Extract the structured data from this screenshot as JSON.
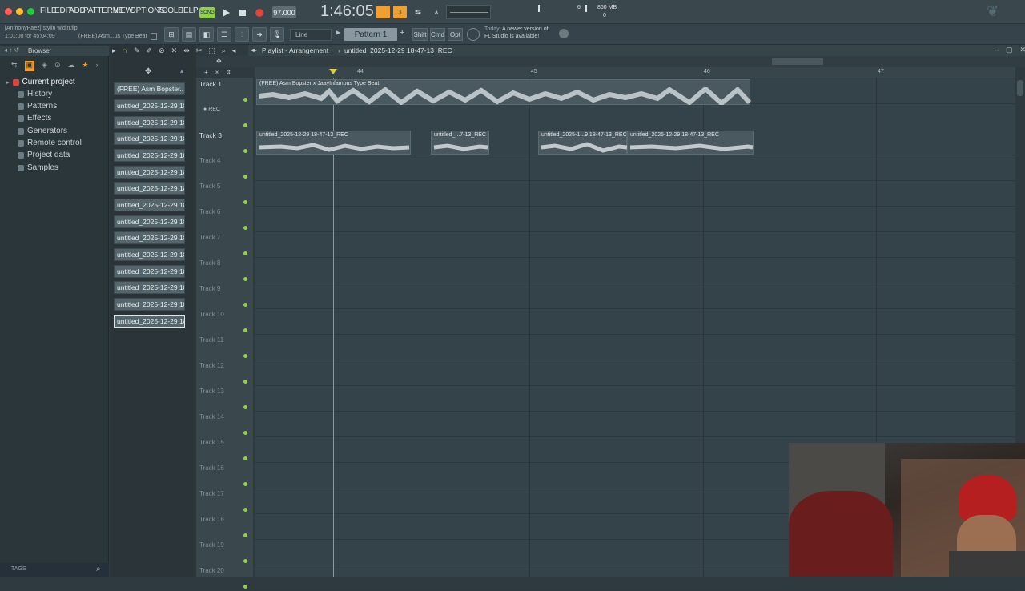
{
  "window": {
    "menu": [
      "FILE",
      "EDIT",
      "ADD",
      "PATTERNS",
      "VIEW",
      "OPTIONS",
      "TOOLS",
      "HELP"
    ],
    "tempo": "97.000",
    "time": "1:46:05",
    "memory": "860 MB",
    "cpu": "6",
    "cpu2": "0"
  },
  "hint": {
    "line1": "[AnthonyPaez] stylin widin.flp",
    "line2": "1:01:00 for 45:04:09",
    "line3": "(FREE) Asm...us Type Beat"
  },
  "toolbar": {
    "snap_label": "Line",
    "pattern_label": "Pattern 1",
    "shift_label": "Shift",
    "cmd_label": "Cmd",
    "opt_label": "Opt",
    "news_today": "Today",
    "news_text1": "A newer version of",
    "news_text2": "FL Studio is available!"
  },
  "browser": {
    "title": "Browser",
    "items": [
      {
        "label": "Current project",
        "icon": "project-icon"
      },
      {
        "label": "History",
        "icon": "history-icon"
      },
      {
        "label": "Patterns",
        "icon": "patterns-icon"
      },
      {
        "label": "Effects",
        "icon": "effects-icon"
      },
      {
        "label": "Generators",
        "icon": "generators-icon"
      },
      {
        "label": "Remote control",
        "icon": "remote-icon"
      },
      {
        "label": "Project data",
        "icon": "data-icon"
      },
      {
        "label": "Samples",
        "icon": "samples-icon"
      }
    ],
    "tags_label": "TAGS"
  },
  "channels": [
    "(FREE) Asm Bopster...",
    "untitled_2025-12-29 18-...",
    "untitled_2025-12-29 18-...",
    "untitled_2025-12-29 18-...",
    "untitled_2025-12-29 18-...",
    "untitled_2025-12-29 18-...",
    "untitled_2025-12-29 18-...",
    "untitled_2025-12-29 18-...",
    "untitled_2025-12-29 18-...",
    "untitled_2025-12-29 18-...",
    "untitled_2025-12-29 18-...",
    "untitled_2025-12-29 18-...",
    "untitled_2025-12-29 18-...",
    "untitled_2025-12-29 18-...",
    "untitled_2025-12-29 18-..."
  ],
  "playlist": {
    "title": "Playlist - Arrangement",
    "breadcrumb": "untitled_2025-12-29 18-47-13_REC",
    "ruler": [
      "44",
      "45",
      "46",
      "47"
    ],
    "tracks": [
      "Track 1",
      "REC",
      "Track 3",
      "Track 4",
      "Track 5",
      "Track 6",
      "Track 7",
      "Track 8",
      "Track 9",
      "Track 10",
      "Track 11",
      "Track 12",
      "Track 13",
      "Track 14",
      "Track 15",
      "Track 16",
      "Track 17",
      "Track 18",
      "Track 19",
      "Track 20"
    ],
    "clips": {
      "beat": "(FREE) Asm Bopster x JaayInfamous Type Beat",
      "rec1": "untitled_2025-12-29 18-47-13_REC",
      "rec2": "untitled_...7-13_REC",
      "rec3": "untitled_2025-1...9 18-47-13_REC",
      "rec4": "untitled_2025-12-29 18-47-13_REC"
    }
  },
  "colors": {
    "accent_green": "#8fd14f",
    "record_red": "#e0443b",
    "orange": "#f0a030"
  }
}
